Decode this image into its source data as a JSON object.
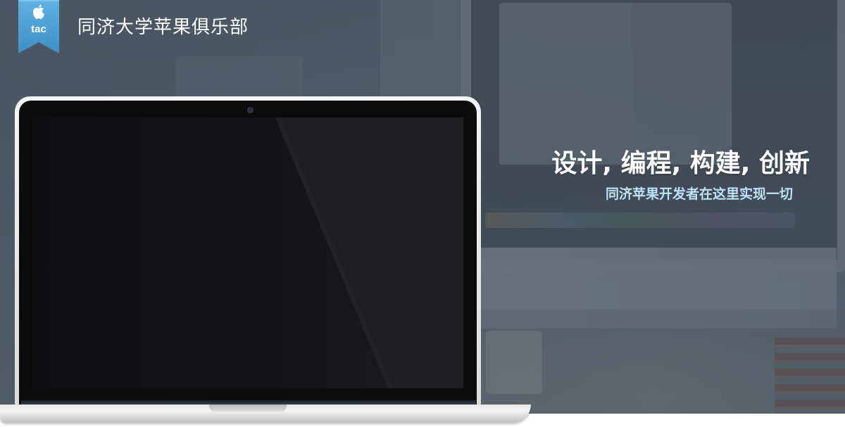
{
  "header": {
    "logo_icon": "apple-logo-icon",
    "logo_text": "tac",
    "site_title": "同济大学苹果俱乐部"
  },
  "hero": {
    "headline": "设计, 编程, 构建, 创新",
    "subheadline": "同济苹果开发者在这里实现一切"
  },
  "colors": {
    "logo_badge": "#4a9fd4",
    "subheadline_text": "#bde2f3",
    "hero_background": "#53606d"
  }
}
